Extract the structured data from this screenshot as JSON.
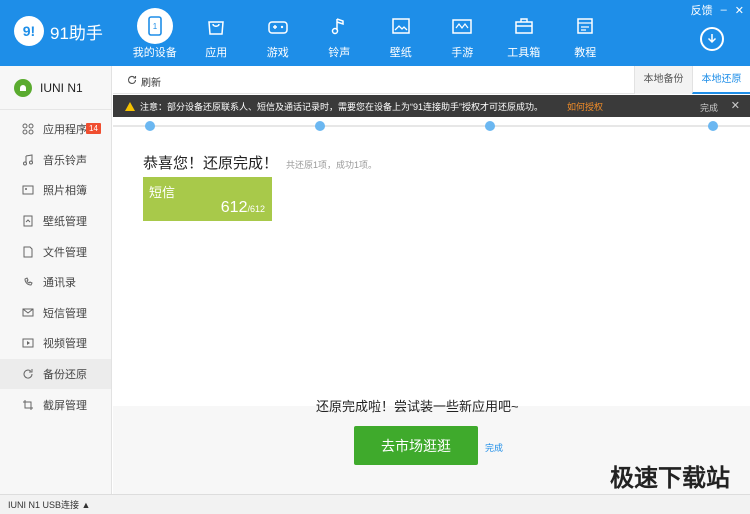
{
  "app": {
    "logo_text": "91助手",
    "logo_glyph": "9!"
  },
  "nav": [
    {
      "label": "我的设备",
      "icon": "phone-icon",
      "active": true
    },
    {
      "label": "应用",
      "icon": "bag-icon"
    },
    {
      "label": "游戏",
      "icon": "gamepad-icon"
    },
    {
      "label": "铃声",
      "icon": "music-note-icon"
    },
    {
      "label": "壁纸",
      "icon": "picture-icon"
    },
    {
      "label": "手游",
      "icon": "handheld-icon"
    },
    {
      "label": "工具箱",
      "icon": "toolbox-icon"
    },
    {
      "label": "教程",
      "icon": "tutorial-icon"
    }
  ],
  "window": {
    "feedback": "反馈",
    "minimize": "–",
    "close": "✕"
  },
  "device": {
    "name": "IUNI N1"
  },
  "sidebar": [
    {
      "label": "应用程序",
      "icon": "apps-icon",
      "badge": "14"
    },
    {
      "label": "音乐铃声",
      "icon": "music-icon"
    },
    {
      "label": "照片相簿",
      "icon": "photo-icon"
    },
    {
      "label": "壁纸管理",
      "icon": "wallpaper-icon"
    },
    {
      "label": "文件管理",
      "icon": "file-icon"
    },
    {
      "label": "通讯录",
      "icon": "contacts-icon"
    },
    {
      "label": "短信管理",
      "icon": "sms-icon"
    },
    {
      "label": "视频管理",
      "icon": "video-icon"
    },
    {
      "label": "备份还原",
      "icon": "backup-icon",
      "active": true
    },
    {
      "label": "截屏管理",
      "icon": "crop-icon"
    }
  ],
  "toolbar": {
    "refresh": "刷新",
    "tab_local_backup": "本地备份",
    "tab_local_restore": "本地还原"
  },
  "notice": {
    "text": "注意：部分设备还原联系人、短信及通话记录时，需要您在设备上为“91连接助手”授权才可还原成功。",
    "link": "如何授权",
    "done": "完成"
  },
  "result": {
    "title": "恭喜您！还原完成！",
    "subtitle": "共还原1项，成功1项。",
    "card_label": "短信",
    "card_count": "612",
    "card_total": "/612"
  },
  "bottom": {
    "promo": "还原完成啦！尝试装一些新应用吧~",
    "market_button": "去市场逛逛",
    "done_link": "完成",
    "watermark": "极速下载站"
  },
  "status": {
    "text": "IUNI N1   USB连接 ▲"
  },
  "colors": {
    "header": "#1e8ee8",
    "card": "#a8c94a",
    "button": "#3faa2c",
    "badge": "#f04e30"
  }
}
